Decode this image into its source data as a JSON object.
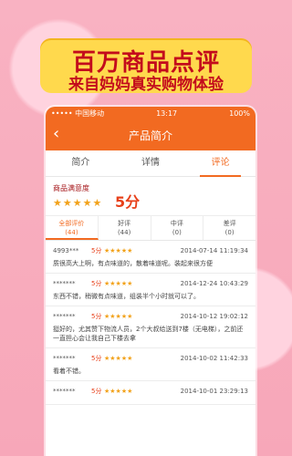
{
  "promo": {
    "title": "百万商品点评",
    "subtitle": "来自妈妈真实购物体验"
  },
  "status": {
    "left": "••••• 中国移动",
    "time": "13:17",
    "right": "100%"
  },
  "header": {
    "title": "产品简介"
  },
  "tabs": [
    "简介",
    "详情",
    "评论"
  ],
  "satisfaction": {
    "label": "商品满意度",
    "stars": "★★★★★",
    "score": "5分"
  },
  "filters": [
    {
      "label": "全部评价",
      "count": "(44)"
    },
    {
      "label": "好评",
      "count": "(44)"
    },
    {
      "label": "中评",
      "count": "(0)"
    },
    {
      "label": "差评",
      "count": "(0)"
    }
  ],
  "reviews": [
    {
      "user": "4993***",
      "score": "5分",
      "time": "2014-07-14 11:19:34",
      "text": "质很高大上啊，有点味道的，散着味道呢。装起来很方便"
    },
    {
      "user": "*******",
      "score": "5分",
      "time": "2014-12-24 10:43:29",
      "text": "东西不错，稍微有点味道，组装半个小时就可以了。"
    },
    {
      "user": "*******",
      "score": "5分",
      "time": "2014-10-12 19:02:12",
      "text": "挺好的，尤其赞下物流人员，2个大叔给送到7楼（无电梯），之前还一直担心会让我自己下楼去拿"
    },
    {
      "user": "*******",
      "score": "5分",
      "time": "2014-10-02 11:42:33",
      "text": "看着不错。"
    },
    {
      "user": "*******",
      "score": "5分",
      "time": "2014-10-01 23:29:13",
      "text": ""
    }
  ],
  "colors": {
    "accent": "#f26a21",
    "background": "#f9b2c2",
    "banner": "#ffd94d"
  }
}
